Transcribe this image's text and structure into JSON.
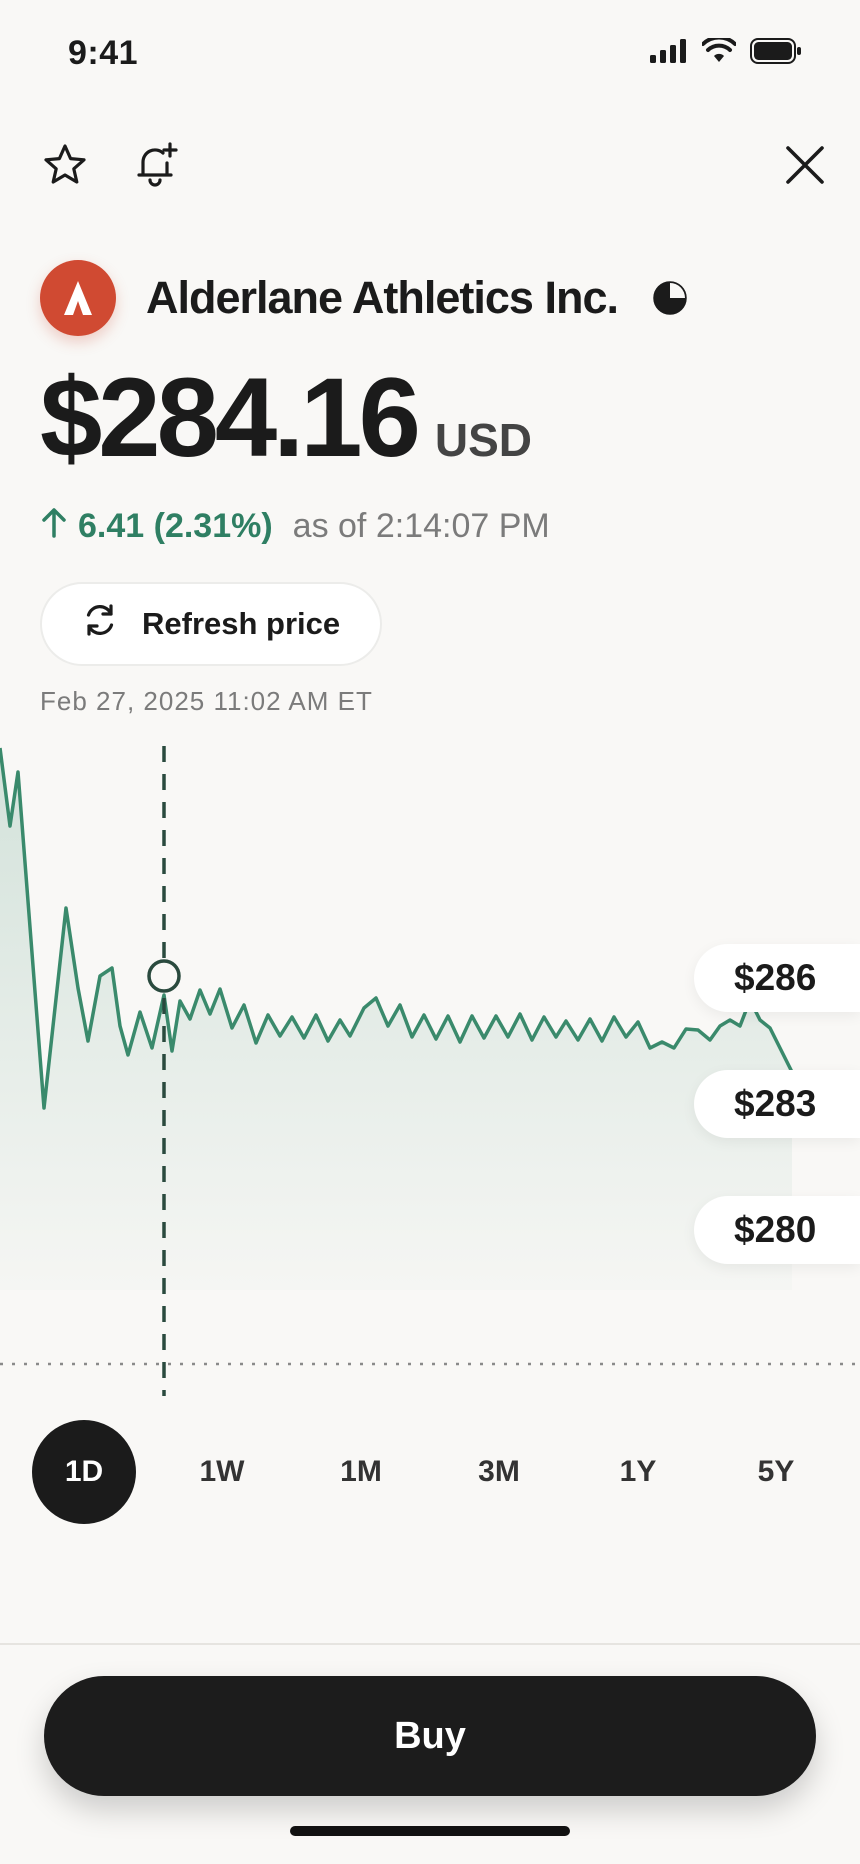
{
  "status_bar": {
    "time": "9:41",
    "icons": [
      "signal-icon",
      "wifi-icon",
      "battery-icon"
    ]
  },
  "toolbar": {
    "icons": [
      "star-icon",
      "bell-plus-icon",
      "close-icon"
    ]
  },
  "company": {
    "name": "Alderlane Athletics Inc.",
    "logo_color": "#d04a32"
  },
  "quote": {
    "price": "$284.16",
    "currency": "USD",
    "change": "6.41 (2.31%)",
    "as_of": "as of 2:14:07 PM",
    "direction": "up",
    "positive_color": "#2f7f63"
  },
  "refresh": {
    "label": "Refresh price"
  },
  "chart": {
    "timestamp": "Feb 27, 2025 11:02 AM ET",
    "price_labels": [
      "$286",
      "$283",
      "$280"
    ],
    "line_color": "#3a8a6c"
  },
  "ranges": [
    {
      "label": "1D",
      "active": true
    },
    {
      "label": "1W",
      "active": false
    },
    {
      "label": "1M",
      "active": false
    },
    {
      "label": "3M",
      "active": false
    },
    {
      "label": "1Y",
      "active": false
    },
    {
      "label": "5Y",
      "active": false
    }
  ],
  "buy": {
    "label": "Buy"
  }
}
